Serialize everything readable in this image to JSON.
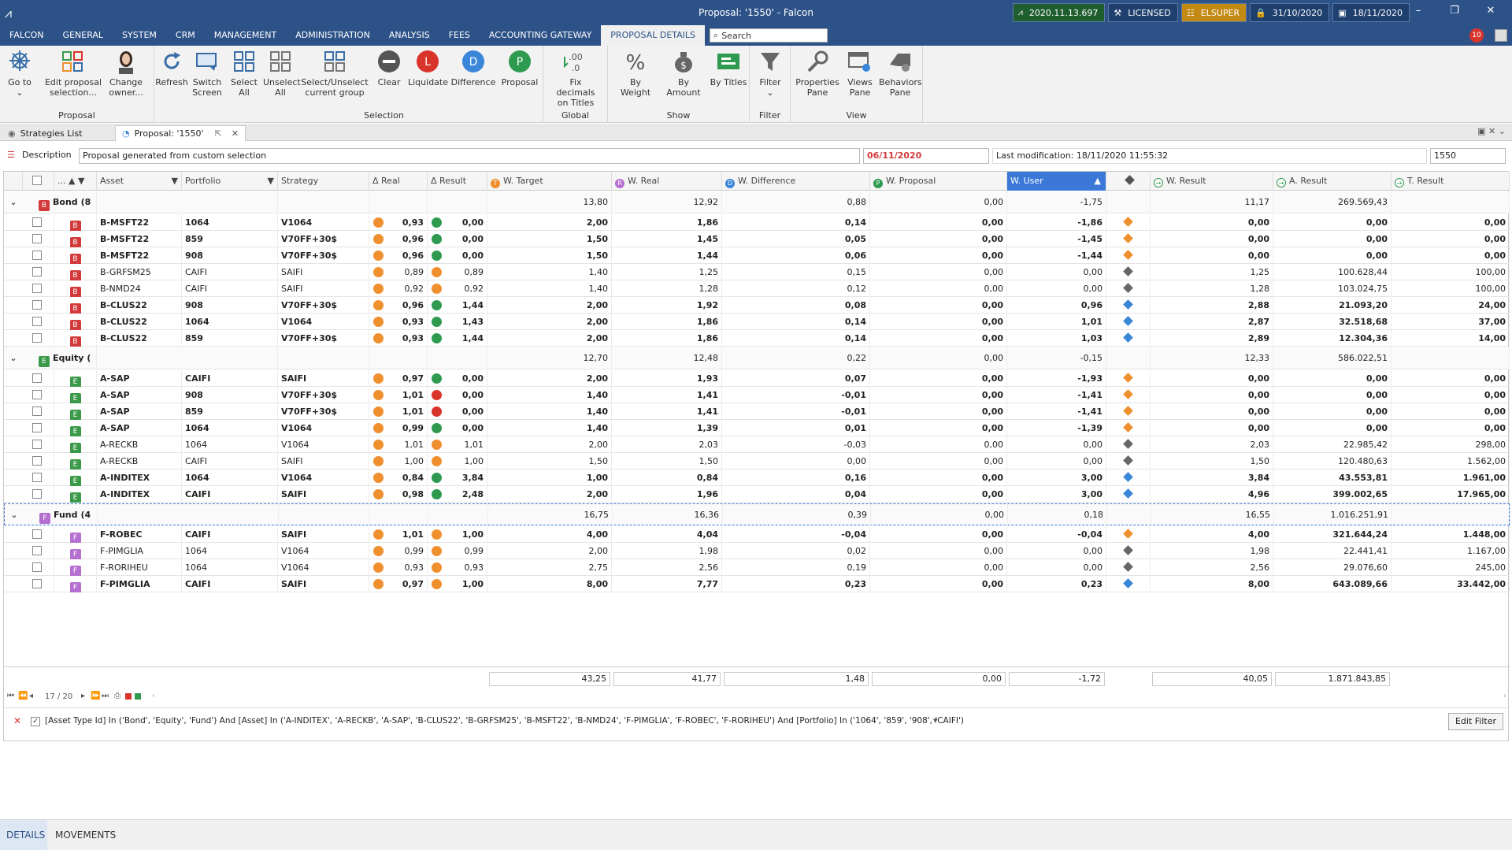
{
  "window": {
    "title": "Proposal: '1550' - Falcon",
    "badges": [
      {
        "label": "2020.11.13.697",
        "style": "green"
      },
      {
        "label": "LICENSED",
        "style": "dark"
      },
      {
        "label": "ELSUPER",
        "style": "gold"
      },
      {
        "label": "31/10/2020",
        "style": "dark"
      },
      {
        "label": "18/11/2020",
        "style": "dark"
      }
    ],
    "notifications": "10"
  },
  "menu": {
    "items": [
      "FALCON",
      "GENERAL",
      "SYSTEM",
      "CRM",
      "MANAGEMENT",
      "ADMINISTRATION",
      "ANALYSIS",
      "FEES",
      "ACCOUNTING GATEWAY",
      "PROPOSAL DETAILS"
    ],
    "active": "PROPOSAL DETAILS",
    "search_placeholder": "Search"
  },
  "ribbon": {
    "groups": {
      "proposal": "Proposal",
      "selection": "Selection",
      "global": "Global",
      "show": "Show",
      "filter": "Filter",
      "view": "View"
    },
    "buttons": {
      "goto": [
        "Go to",
        ""
      ],
      "edit_selection": [
        "Edit proposal",
        "selection..."
      ],
      "change_owner": [
        "Change",
        "owner..."
      ],
      "refresh": [
        "Refresh",
        ""
      ],
      "switch_screen": [
        "Switch",
        "Screen"
      ],
      "select_all": [
        "Select",
        "All"
      ],
      "unselect_all": [
        "Unselect",
        "All"
      ],
      "select_group": [
        "Select/Unselect",
        "current group"
      ],
      "clear": [
        "Clear",
        ""
      ],
      "liquidate": [
        "Liquidate",
        ""
      ],
      "difference": [
        "Difference",
        ""
      ],
      "proposal": [
        "Proposal",
        ""
      ],
      "fix_decimals": [
        "Fix decimals",
        "on Titles"
      ],
      "by_weight": [
        "By Weight",
        ""
      ],
      "by_amount": [
        "By Amount",
        ""
      ],
      "by_titles": [
        "By Titles",
        ""
      ],
      "filter": [
        "Filter",
        ""
      ],
      "properties": [
        "Properties",
        "Pane"
      ],
      "views": [
        "Views",
        "Pane"
      ],
      "behaviors": [
        "Behaviors",
        "Pane"
      ]
    },
    "icon_letters": {
      "liquidate": "L",
      "difference": "D",
      "proposal": "P"
    }
  },
  "tabs": {
    "strategies": "Strategies List",
    "proposal": "Proposal: '1550'"
  },
  "description": {
    "label": "Description",
    "value": "Proposal generated from custom selection",
    "date": "06/11/2020",
    "last_mod": "Last modification: 18/11/2020 11:55:32",
    "id": "1550"
  },
  "columns": {
    "dots": "...",
    "asset": "Asset",
    "portfolio": "Portfolio",
    "strategy": "Strategy",
    "real": "Real",
    "result": "Result",
    "w_target": "W. Target",
    "w_real": "W. Real",
    "w_difference": "W. Difference",
    "w_proposal": "W. Proposal",
    "w_user": "W. User",
    "w_result": "W. Result",
    "a_result": "A. Result",
    "t_result": "T. Result"
  },
  "groups": [
    {
      "name": "Bond",
      "count": "(8",
      "letter": "B",
      "color": "#d23b3b",
      "totals": [
        "13,80",
        "12,92",
        "0,88",
        "0,00",
        "-1,75",
        "11,17",
        "269.569,43"
      ],
      "rows": [
        {
          "asset": "B-MSFT22",
          "portfolio": "1064",
          "strategy": "V1064",
          "real": "0,93",
          "realc": "#ef8f2e",
          "result": "0,00",
          "resc": "#2e9a4f",
          "wt": "2,00",
          "wr": "1,86",
          "wd": "0,14",
          "wp": "0,00",
          "wu": "-1,86",
          "dia": "#ef8f2e",
          "wres": "0,00",
          "ares": "0,00",
          "tres": "0,00",
          "bold": true
        },
        {
          "asset": "B-MSFT22",
          "portfolio": "859",
          "strategy": "V70FF+30$",
          "real": "0,96",
          "realc": "#ef8f2e",
          "result": "0,00",
          "resc": "#2e9a4f",
          "wt": "1,50",
          "wr": "1,45",
          "wd": "0,05",
          "wp": "0,00",
          "wu": "-1,45",
          "dia": "#ef8f2e",
          "wres": "0,00",
          "ares": "0,00",
          "tres": "0,00",
          "bold": true
        },
        {
          "asset": "B-MSFT22",
          "portfolio": "908",
          "strategy": "V70FF+30$",
          "real": "0,96",
          "realc": "#ef8f2e",
          "result": "0,00",
          "resc": "#2e9a4f",
          "wt": "1,50",
          "wr": "1,44",
          "wd": "0,06",
          "wp": "0,00",
          "wu": "-1,44",
          "dia": "#ef8f2e",
          "wres": "0,00",
          "ares": "0,00",
          "tres": "0,00",
          "bold": true
        },
        {
          "asset": "B-GRFSM25",
          "portfolio": "CAIFI",
          "strategy": "SAIFI",
          "real": "0,89",
          "realc": "#ef8f2e",
          "result": "0,89",
          "resc": "#ef8f2e",
          "wt": "1,40",
          "wr": "1,25",
          "wd": "0,15",
          "wp": "0,00",
          "wu": "0,00",
          "dia": "#666666",
          "wres": "1,25",
          "ares": "100.628,44",
          "tres": "100,00",
          "bold": false
        },
        {
          "asset": "B-NMD24",
          "portfolio": "CAIFI",
          "strategy": "SAIFI",
          "real": "0,92",
          "realc": "#ef8f2e",
          "result": "0,92",
          "resc": "#ef8f2e",
          "wt": "1,40",
          "wr": "1,28",
          "wd": "0,12",
          "wp": "0,00",
          "wu": "0,00",
          "dia": "#666666",
          "wres": "1,28",
          "ares": "103.024,75",
          "tres": "100,00",
          "bold": false
        },
        {
          "asset": "B-CLUS22",
          "portfolio": "908",
          "strategy": "V70FF+30$",
          "real": "0,96",
          "realc": "#ef8f2e",
          "result": "1,44",
          "resc": "#2e9a4f",
          "wt": "2,00",
          "wr": "1,92",
          "wd": "0,08",
          "wp": "0,00",
          "wu": "0,96",
          "dia": "#3a86d8",
          "wres": "2,88",
          "ares": "21.093,20",
          "tres": "24,00",
          "bold": true
        },
        {
          "asset": "B-CLUS22",
          "portfolio": "1064",
          "strategy": "V1064",
          "real": "0,93",
          "realc": "#ef8f2e",
          "result": "1,43",
          "resc": "#2e9a4f",
          "wt": "2,00",
          "wr": "1,86",
          "wd": "0,14",
          "wp": "0,00",
          "wu": "1,01",
          "dia": "#3a86d8",
          "wres": "2,87",
          "ares": "32.518,68",
          "tres": "37,00",
          "bold": true
        },
        {
          "asset": "B-CLUS22",
          "portfolio": "859",
          "strategy": "V70FF+30$",
          "real": "0,93",
          "realc": "#ef8f2e",
          "result": "1,44",
          "resc": "#2e9a4f",
          "wt": "2,00",
          "wr": "1,86",
          "wd": "0,14",
          "wp": "0,00",
          "wu": "1,03",
          "dia": "#3a86d8",
          "wres": "2,89",
          "ares": "12.304,36",
          "tres": "14,00",
          "bold": true
        }
      ]
    },
    {
      "name": "Equity",
      "count": "(",
      "letter": "E",
      "color": "#3a9a4a",
      "totals": [
        "12,70",
        "12,48",
        "0,22",
        "0,00",
        "-0,15",
        "12,33",
        "586.022,51"
      ],
      "rows": [
        {
          "asset": "A-SAP",
          "portfolio": "CAIFI",
          "strategy": "SAIFI",
          "real": "0,97",
          "realc": "#ef8f2e",
          "result": "0,00",
          "resc": "#2e9a4f",
          "wt": "2,00",
          "wr": "1,93",
          "wd": "0,07",
          "wp": "0,00",
          "wu": "-1,93",
          "dia": "#ef8f2e",
          "wres": "0,00",
          "ares": "0,00",
          "tres": "0,00",
          "bold": true
        },
        {
          "asset": "A-SAP",
          "portfolio": "908",
          "strategy": "V70FF+30$",
          "real": "1,01",
          "realc": "#ef8f2e",
          "result": "0,00",
          "resc": "#d9342b",
          "wt": "1,40",
          "wr": "1,41",
          "wd": "-0,01",
          "wp": "0,00",
          "wu": "-1,41",
          "dia": "#ef8f2e",
          "wres": "0,00",
          "ares": "0,00",
          "tres": "0,00",
          "bold": true
        },
        {
          "asset": "A-SAP",
          "portfolio": "859",
          "strategy": "V70FF+30$",
          "real": "1,01",
          "realc": "#ef8f2e",
          "result": "0,00",
          "resc": "#d9342b",
          "wt": "1,40",
          "wr": "1,41",
          "wd": "-0,01",
          "wp": "0,00",
          "wu": "-1,41",
          "dia": "#ef8f2e",
          "wres": "0,00",
          "ares": "0,00",
          "tres": "0,00",
          "bold": true
        },
        {
          "asset": "A-SAP",
          "portfolio": "1064",
          "strategy": "V1064",
          "real": "0,99",
          "realc": "#ef8f2e",
          "result": "0,00",
          "resc": "#2e9a4f",
          "wt": "1,40",
          "wr": "1,39",
          "wd": "0,01",
          "wp": "0,00",
          "wu": "-1,39",
          "dia": "#ef8f2e",
          "wres": "0,00",
          "ares": "0,00",
          "tres": "0,00",
          "bold": true
        },
        {
          "asset": "A-RECKB",
          "portfolio": "1064",
          "strategy": "V1064",
          "real": "1,01",
          "realc": "#ef8f2e",
          "result": "1,01",
          "resc": "#ef8f2e",
          "wt": "2,00",
          "wr": "2,03",
          "wd": "-0,03",
          "wp": "0,00",
          "wu": "0,00",
          "dia": "#666666",
          "wres": "2,03",
          "ares": "22.985,42",
          "tres": "298,00",
          "bold": false
        },
        {
          "asset": "A-RECKB",
          "portfolio": "CAIFI",
          "strategy": "SAIFI",
          "real": "1,00",
          "realc": "#ef8f2e",
          "result": "1,00",
          "resc": "#ef8f2e",
          "wt": "1,50",
          "wr": "1,50",
          "wd": "0,00",
          "wp": "0,00",
          "wu": "0,00",
          "dia": "#666666",
          "wres": "1,50",
          "ares": "120.480,63",
          "tres": "1.562,00",
          "bold": false
        },
        {
          "asset": "A-INDITEX",
          "portfolio": "1064",
          "strategy": "V1064",
          "real": "0,84",
          "realc": "#ef8f2e",
          "result": "3,84",
          "resc": "#2e9a4f",
          "wt": "1,00",
          "wr": "0,84",
          "wd": "0,16",
          "wp": "0,00",
          "wu": "3,00",
          "dia": "#3a86d8",
          "wres": "3,84",
          "ares": "43.553,81",
          "tres": "1.961,00",
          "bold": true
        },
        {
          "asset": "A-INDITEX",
          "portfolio": "CAIFI",
          "strategy": "SAIFI",
          "real": "0,98",
          "realc": "#ef8f2e",
          "result": "2,48",
          "resc": "#2e9a4f",
          "wt": "2,00",
          "wr": "1,96",
          "wd": "0,04",
          "wp": "0,00",
          "wu": "3,00",
          "dia": "#3a86d8",
          "wres": "4,96",
          "ares": "399.002,65",
          "tres": "17.965,00",
          "bold": true
        }
      ]
    },
    {
      "name": "Fund",
      "count": "(4",
      "letter": "F",
      "color": "#b46fd0",
      "totals": [
        "16,75",
        "16,36",
        "0,39",
        "0,00",
        "0,18",
        "16,55",
        "1.016.251,91"
      ],
      "rows": [
        {
          "asset": "F-ROBEC",
          "portfolio": "CAIFI",
          "strategy": "SAIFI",
          "real": "1,01",
          "realc": "#ef8f2e",
          "result": "1,00",
          "resc": "#ef8f2e",
          "wt": "4,00",
          "wr": "4,04",
          "wd": "-0,04",
          "wp": "0,00",
          "wu": "-0,04",
          "dia": "#ef8f2e",
          "wres": "4,00",
          "ares": "321.644,24",
          "tres": "1.448,00",
          "bold": true
        },
        {
          "asset": "F-PIMGLIA",
          "portfolio": "1064",
          "strategy": "V1064",
          "real": "0,99",
          "realc": "#ef8f2e",
          "result": "0,99",
          "resc": "#ef8f2e",
          "wt": "2,00",
          "wr": "1,98",
          "wd": "0,02",
          "wp": "0,00",
          "wu": "0,00",
          "dia": "#666666",
          "wres": "1,98",
          "ares": "22.441,41",
          "tres": "1.167,00",
          "bold": false
        },
        {
          "asset": "F-RORIHEU",
          "portfolio": "1064",
          "strategy": "V1064",
          "real": "0,93",
          "realc": "#ef8f2e",
          "result": "0,93",
          "resc": "#ef8f2e",
          "wt": "2,75",
          "wr": "2,56",
          "wd": "0,19",
          "wp": "0,00",
          "wu": "0,00",
          "dia": "#666666",
          "wres": "2,56",
          "ares": "29.076,60",
          "tres": "245,00",
          "bold": false
        },
        {
          "asset": "F-PIMGLIA",
          "portfolio": "CAIFI",
          "strategy": "SAIFI",
          "real": "0,97",
          "realc": "#ef8f2e",
          "result": "1,00",
          "resc": "#ef8f2e",
          "wt": "8,00",
          "wr": "7,77",
          "wd": "0,23",
          "wp": "0,00",
          "wu": "0,23",
          "dia": "#3a86d8",
          "wres": "8,00",
          "ares": "643.089,66",
          "tres": "33.442,00",
          "bold": true
        }
      ]
    }
  ],
  "totals": [
    "43,25",
    "41,77",
    "1,48",
    "0,00",
    "-1,72",
    "40,05",
    "1.871.843,85"
  ],
  "pager": "17 / 20",
  "filter_text": "[Asset Type Id] In ('Bond', 'Equity', 'Fund') And [Asset] In ('A-INDITEX', 'A-RECKB', 'A-SAP', 'B-CLUS22', 'B-GRFSM25', 'B-MSFT22', 'B-NMD24', 'F-PIMGLIA', 'F-ROBEC', 'F-RORIHEU') And [Portfolio] In ('1064', '859', '908', 'CAIFI')",
  "edit_filter": "Edit Filter",
  "bottom_tabs": [
    "DETAILS",
    "MOVEMENTS"
  ]
}
